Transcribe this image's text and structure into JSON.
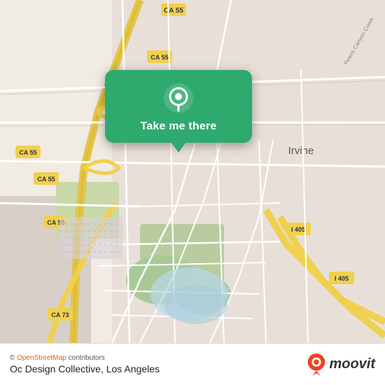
{
  "map": {
    "background_color": "#e8e0d8",
    "popup": {
      "label": "Take me there",
      "bg_color": "#2eaa6e"
    }
  },
  "bottom_bar": {
    "attribution": "© OpenStreetMap contributors",
    "location": "Oc Design Collective, Los Angeles",
    "logo": "moovit"
  }
}
